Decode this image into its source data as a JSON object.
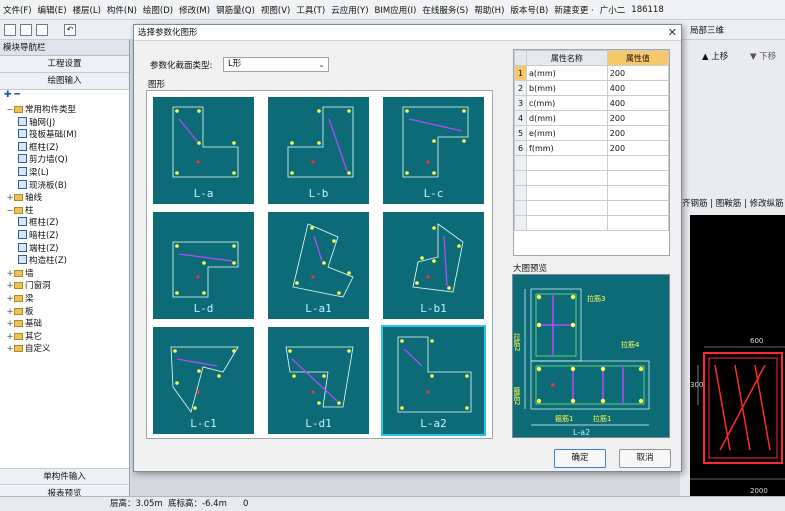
{
  "menu": [
    "文件(F)",
    "编辑(E)",
    "楼层(L)",
    "构件(N)",
    "绘图(D)",
    "修改(M)",
    "钢筋量(Q)",
    "视图(V)",
    "工具(T)",
    "云应用(Y)",
    "BIM应用(I)",
    "在线服务(S)",
    "帮助(H)",
    "版本号(B)",
    "新建变更 ·",
    "广小二",
    "186118"
  ],
  "left_pane": {
    "title": "模块导航栏",
    "btn_project": "工程设置",
    "btn_draw": "绘图输入",
    "tree": [
      {
        "label": "常用构件类型",
        "indent": 1,
        "kind": "folder",
        "exp": "−"
      },
      {
        "label": "轴网(J)",
        "indent": 3,
        "kind": "item"
      },
      {
        "label": "筏板基础(M)",
        "indent": 3,
        "kind": "item"
      },
      {
        "label": "框柱(Z)",
        "indent": 3,
        "kind": "item"
      },
      {
        "label": "剪力墙(Q)",
        "indent": 3,
        "kind": "item"
      },
      {
        "label": "梁(L)",
        "indent": 3,
        "kind": "item"
      },
      {
        "label": "现浇板(B)",
        "indent": 3,
        "kind": "item"
      },
      {
        "label": "轴线",
        "indent": 1,
        "kind": "folder",
        "exp": "+"
      },
      {
        "label": "柱",
        "indent": 1,
        "kind": "folder",
        "exp": "−"
      },
      {
        "label": "框柱(Z)",
        "indent": 3,
        "kind": "item"
      },
      {
        "label": "暗柱(Z)",
        "indent": 3,
        "kind": "item"
      },
      {
        "label": "端柱(Z)",
        "indent": 3,
        "kind": "item"
      },
      {
        "label": "构造柱(Z)",
        "indent": 3,
        "kind": "item"
      },
      {
        "label": "墙",
        "indent": 1,
        "kind": "folder",
        "exp": "+"
      },
      {
        "label": "门窗洞",
        "indent": 1,
        "kind": "folder",
        "exp": "+"
      },
      {
        "label": "梁",
        "indent": 1,
        "kind": "folder",
        "exp": "+"
      },
      {
        "label": "板",
        "indent": 1,
        "kind": "folder",
        "exp": "+"
      },
      {
        "label": "基础",
        "indent": 1,
        "kind": "folder",
        "exp": "+"
      },
      {
        "label": "其它",
        "indent": 1,
        "kind": "folder",
        "exp": "+"
      },
      {
        "label": "自定义",
        "indent": 1,
        "kind": "folder",
        "exp": "+"
      }
    ],
    "btn_single": "单构件输入",
    "btn_report": "报表预览"
  },
  "right_toolbar": {
    "view3d": "局部三维",
    "up": "上移",
    "down": "下移",
    "tab_a": "齐钢筋",
    "tab_b": "图鞍筋",
    "tab_c": "修改纵筋"
  },
  "status": {
    "floor_height": "层高：3.05m",
    "bottom_elev": "底标高：-6.4m",
    "zero": "0"
  },
  "dialog": {
    "title": "选择参数化图形",
    "type_label": "参数化截面类型:",
    "type_value": "L形",
    "shapes_label": "图形",
    "shapes": [
      "L-a",
      "L-b",
      "L-c",
      "L-d",
      "L-a1",
      "L-b1",
      "L-c1",
      "L-d1",
      "L-a2"
    ],
    "selected_shape": "L-a2",
    "table_headers": [
      "属性名称",
      "属性值"
    ],
    "table_rows": [
      {
        "no": "1",
        "name": "a(mm)",
        "value": "200"
      },
      {
        "no": "2",
        "name": "b(mm)",
        "value": "400"
      },
      {
        "no": "3",
        "name": "c(mm)",
        "value": "400"
      },
      {
        "no": "4",
        "name": "d(mm)",
        "value": "200"
      },
      {
        "no": "5",
        "name": "e(mm)",
        "value": "200"
      },
      {
        "no": "6",
        "name": "f(mm)",
        "value": "200"
      }
    ],
    "preview_label": "大图预览",
    "preview_labels": {
      "tie3": "拉筋3",
      "tie4": "拉筋4",
      "tie2": "拉筋2",
      "stir2": "箍筋2",
      "stir1": "箍筋1",
      "tie1": "拉筋1",
      "cap": "L-a2"
    },
    "ok": "确定",
    "cancel": "取消"
  },
  "cad_numbers": [
    "600",
    "300",
    "2000"
  ],
  "colors": {
    "tile_bg": "#0d6b77",
    "rebar": "#ffff4d",
    "tie": "#b04cff",
    "dim": "#e8ffff",
    "accent": "#f6c86a"
  }
}
